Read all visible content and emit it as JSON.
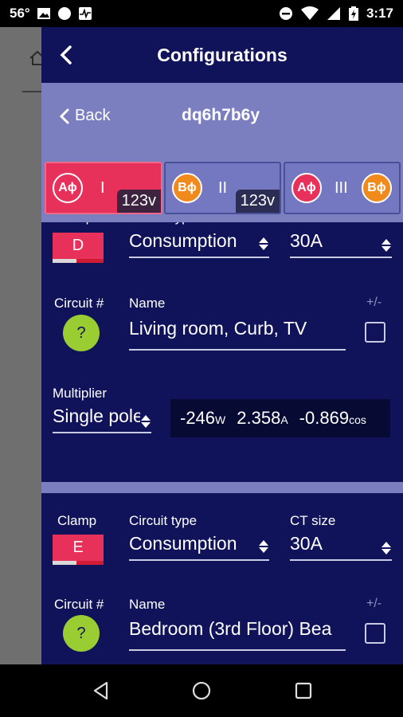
{
  "status_bar": {
    "temperature": "56°",
    "time": "3:17",
    "icons": [
      "image-icon",
      "circle-icon",
      "pulse-icon",
      "dnd-icon",
      "wifi-icon",
      "signal-icon",
      "battery-icon"
    ]
  },
  "header": {
    "title": "Configurations",
    "back_label": "Back",
    "device_id": "dq6h7b6y"
  },
  "phases": [
    {
      "left_badge": "Aϕ",
      "roman": "I",
      "voltage": "123v",
      "active": true
    },
    {
      "left_badge": "Bϕ",
      "roman": "II",
      "voltage": "123v",
      "active": false
    },
    {
      "left_badge": "Aϕ",
      "roman": "III",
      "right_badge": "Bϕ",
      "active": false
    }
  ],
  "labels": {
    "clamp": "Clamp",
    "circuit_type": "Circuit type",
    "ct_size": "CT size",
    "circuit_num": "Circuit #",
    "name": "Name",
    "plus_minus": "+/-",
    "multiplier": "Multiplier"
  },
  "circuits": [
    {
      "clamp": "D",
      "circuit_type": "Consumption",
      "ct_size": "30A",
      "circuit_number": "?",
      "name": "Living room, Curb, TV",
      "multiplier": "Single pole",
      "readings": {
        "watts": "-246",
        "watts_unit": "W",
        "amps": "2.358",
        "amps_unit": "A",
        "pf": "-0.869",
        "pf_unit": "cos"
      }
    },
    {
      "clamp": "E",
      "circuit_type": "Consumption",
      "ct_size": "30A",
      "circuit_number": "?",
      "name": "Bedroom (3rd Floor) Bea"
    }
  ],
  "colors": {
    "panel": "#10125a",
    "subbar": "#7b7fbf",
    "phase_a": "#e8315a",
    "phase_b": "#f08a1c",
    "circuit_badge": "#9acd32"
  }
}
